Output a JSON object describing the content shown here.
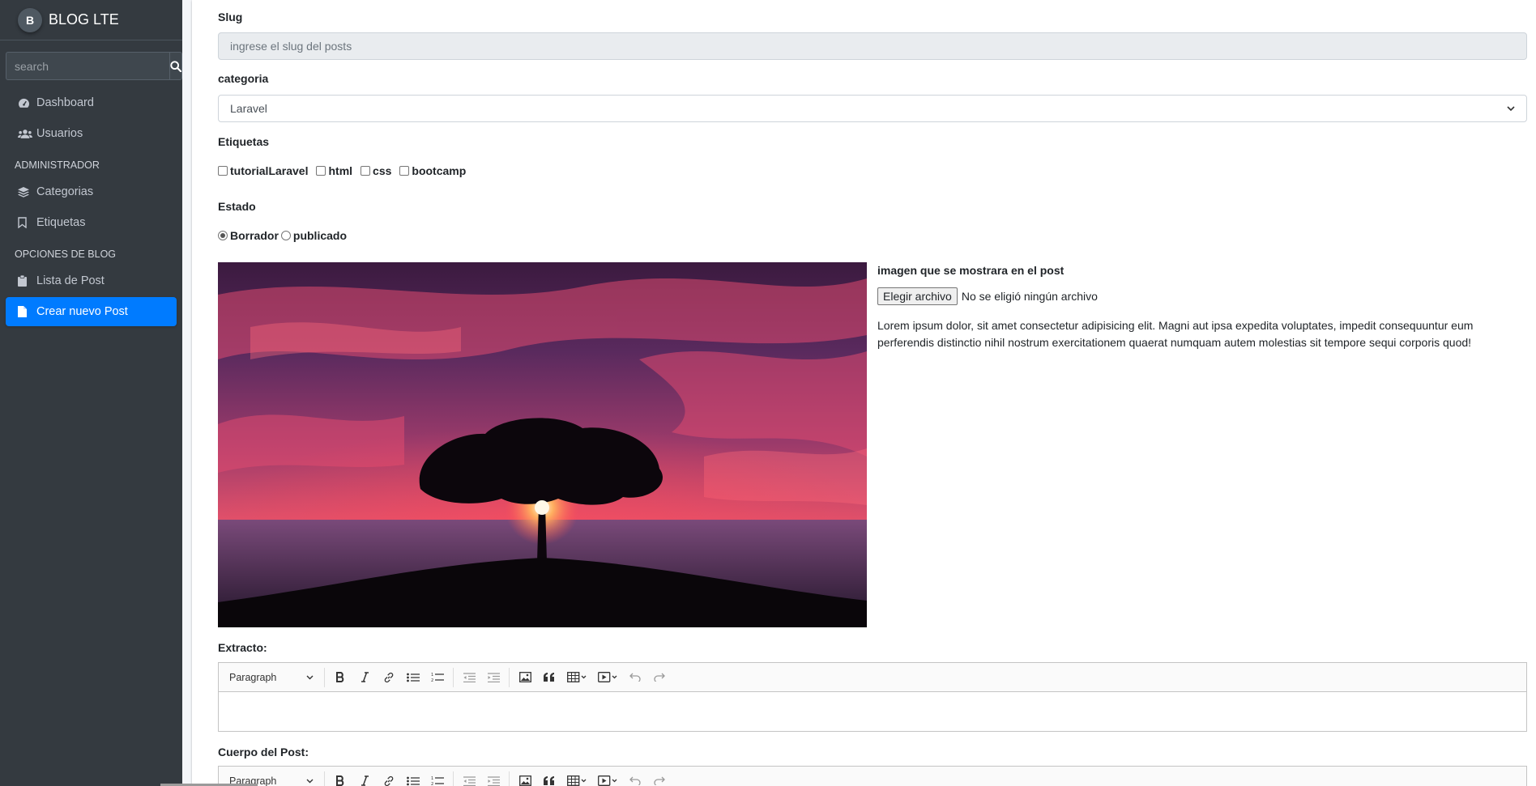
{
  "brand": {
    "logo_letter": "B",
    "name_bold": "BLOG",
    "name_light": " LTE"
  },
  "search": {
    "placeholder": "search"
  },
  "sidebar": {
    "items_top": [
      {
        "label": "Dashboard",
        "icon": "tachometer-icon"
      },
      {
        "label": "Usuarios",
        "icon": "users-icon"
      }
    ],
    "header_admin": "ADMINISTRADOR",
    "items_admin": [
      {
        "label": "Categorias",
        "icon": "layers-icon"
      },
      {
        "label": "Etiquetas",
        "icon": "bookmark-icon"
      }
    ],
    "header_blog": "OPCIONES DE BLOG",
    "items_blog": [
      {
        "label": "Lista de Post",
        "icon": "clipboard-icon"
      },
      {
        "label": "Crear nuevo Post",
        "icon": "file-icon",
        "active": true
      }
    ]
  },
  "form": {
    "slug_label": "Slug",
    "slug_placeholder": "ingrese el slug del posts",
    "categoria_label": "categoria",
    "categoria_selected": "Laravel",
    "etiquetas_label": "Etiquetas",
    "etiquetas": [
      "tutorialLaravel",
      "html",
      "css",
      "bootcamp"
    ],
    "estado_label": "Estado",
    "estado_options": [
      "Borrador",
      "publicado"
    ],
    "estado_selected": "Borrador",
    "imagen_label": "imagen que se mostrara en el post",
    "file_button": "Elegir archivo",
    "file_status": "No se eligió ningún archivo",
    "lorem": "Lorem ipsum dolor, sit amet consectetur adipisicing elit. Magni aut ipsa expedita voluptates, impedit consequuntur eum perferendis distinctio nihil nostrum exercitationem quaerat numquam autem molestias sit tempore sequi corporis quod!",
    "extracto_label": "Extracto:",
    "cuerpo_label": "Cuerpo del Post:",
    "editor_paragraph": "Paragraph"
  },
  "colors": {
    "sidebar": "#343a40",
    "active": "#007bff"
  }
}
